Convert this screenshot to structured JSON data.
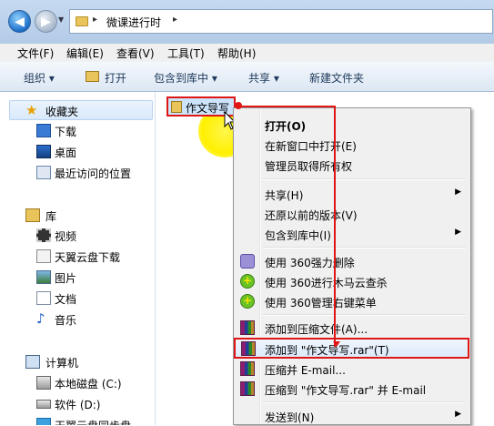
{
  "address": {
    "path": "微课进行时",
    "arrow": "▸"
  },
  "menubar": [
    "文件(F)",
    "编辑(E)",
    "查看(V)",
    "工具(T)",
    "帮助(H)"
  ],
  "toolbar": {
    "organize": "组织 ▾",
    "open": "打开",
    "include": "包含到库中 ▾",
    "share": "共享 ▾",
    "newfolder": "新建文件夹"
  },
  "nav": {
    "favorites": "收藏夹",
    "downloads": "下载",
    "desktop": "桌面",
    "recent": "最近访问的位置",
    "libraries": "库",
    "videos": "视频",
    "tianyi": "天翼云盘下载",
    "pictures": "图片",
    "documents": "文档",
    "music": "音乐",
    "computer": "计算机",
    "localdisk": "本地磁盘 (C:)",
    "software": "软件 (D:)",
    "partial": "天翼云盘同步盘"
  },
  "content": {
    "folder_name": "作文导写"
  },
  "context_menu": {
    "open": "打开(O)",
    "open_new": "在新窗口中打开(E)",
    "admin": "管理员取得所有权",
    "share": "共享(H)",
    "restore": "还原以前的版本(V)",
    "include": "包含到库中(I)",
    "shred360": "使用 360强力删除",
    "trojan360": "使用 360进行木马云查杀",
    "manage360": "使用 360管理右键菜单",
    "add_archive": "添加到压缩文件(A)...",
    "add_rar": "添加到 \"作文导写.rar\"(T)",
    "compress_email": "压缩并 E-mail...",
    "compress_rar_email": "压缩到 \"作文导写.rar\" 并 E-mail",
    "sendto": "发送到(N)"
  },
  "colors": {
    "highlight_red": "#e01616",
    "cursor_glow": "#fff000",
    "selection": "#cce4fb"
  }
}
